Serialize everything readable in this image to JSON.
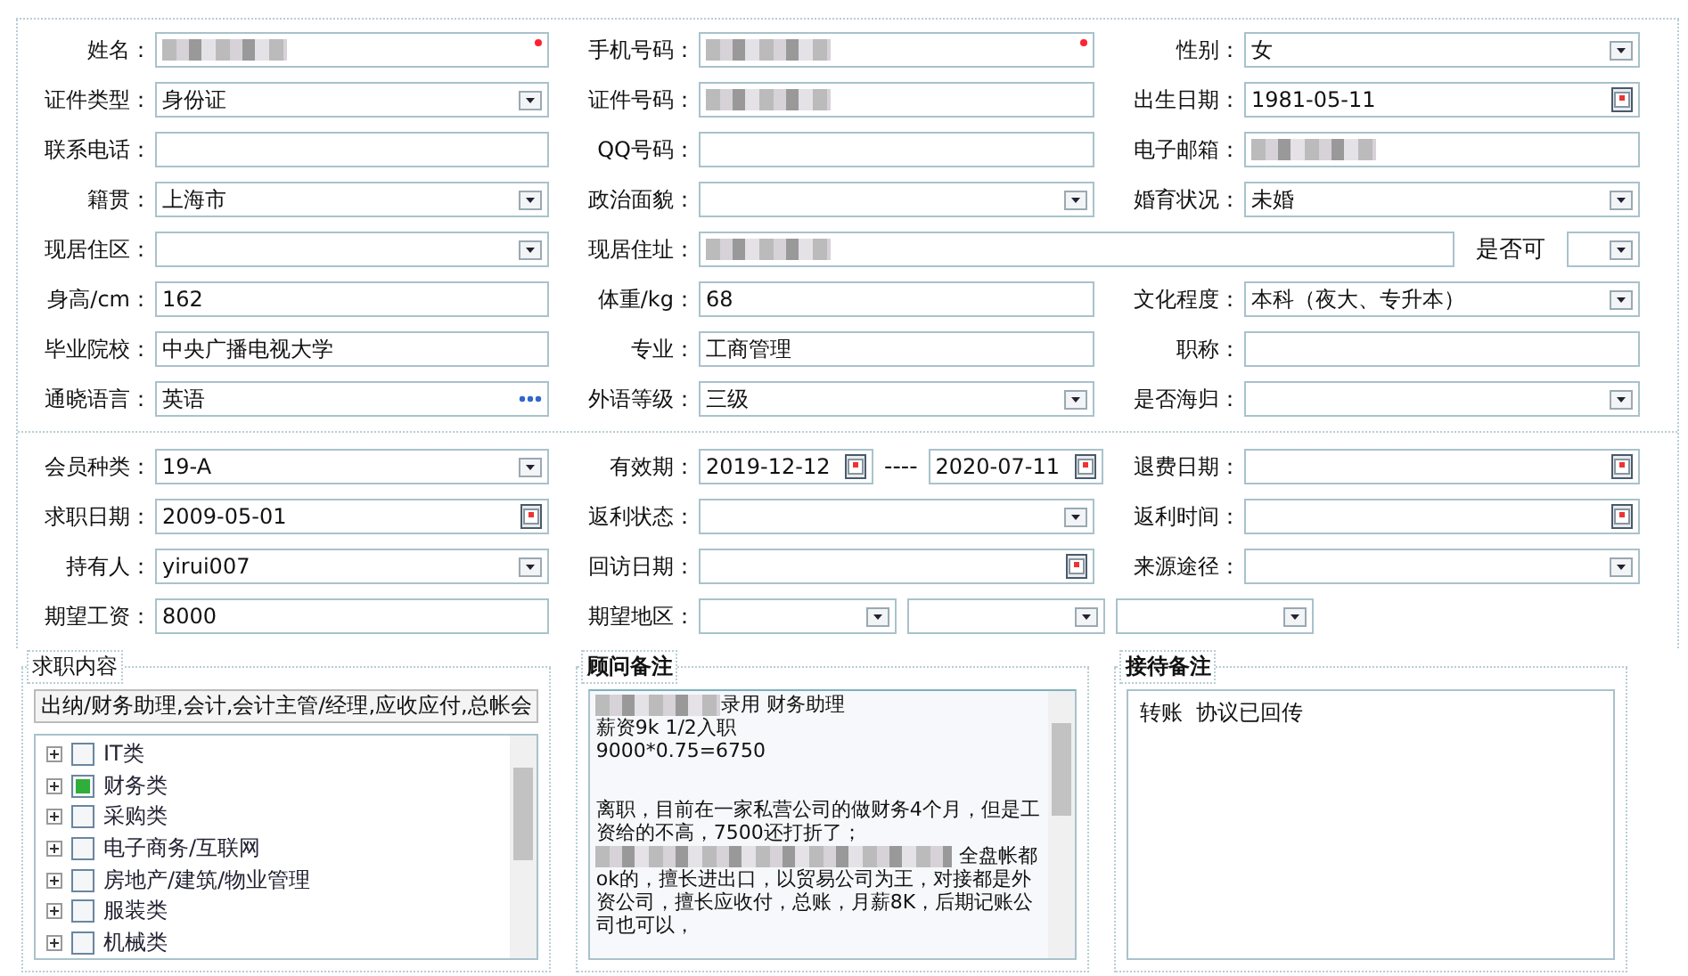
{
  "sections": [
    {
      "rows": [
        [
          {
            "label": "姓名：",
            "inputs": [
              {
                "kind": "text",
                "redacted": true,
                "required": true
              }
            ]
          },
          {
            "label": "手机号码：",
            "inputs": [
              {
                "kind": "text",
                "redacted": true,
                "required": true
              }
            ]
          },
          {
            "label": "性别：",
            "inputs": [
              {
                "kind": "select",
                "value": "女"
              }
            ]
          }
        ],
        [
          {
            "label": "证件类型：",
            "inputs": [
              {
                "kind": "select",
                "value": "身份证"
              }
            ]
          },
          {
            "label": "证件号码：",
            "inputs": [
              {
                "kind": "text",
                "redacted": true
              }
            ]
          },
          {
            "label": "出生日期：",
            "inputs": [
              {
                "kind": "date",
                "value": "1981-05-11"
              }
            ]
          }
        ],
        [
          {
            "label": "联系电话：",
            "inputs": [
              {
                "kind": "text"
              }
            ]
          },
          {
            "label": "QQ号码：",
            "inputs": [
              {
                "kind": "text"
              }
            ]
          },
          {
            "label": "电子邮箱：",
            "inputs": [
              {
                "kind": "text",
                "redacted": true
              }
            ]
          }
        ],
        [
          {
            "label": "籍贯：",
            "inputs": [
              {
                "kind": "select",
                "value": "上海市"
              }
            ]
          },
          {
            "label": "政治面貌：",
            "inputs": [
              {
                "kind": "select"
              }
            ]
          },
          {
            "label": "婚育状况：",
            "inputs": [
              {
                "kind": "select",
                "value": "未婚"
              }
            ]
          }
        ],
        [
          {
            "label": "现居住区：",
            "inputs": [
              {
                "kind": "select"
              }
            ]
          },
          {
            "label": "现居住址：",
            "wide": true,
            "inputs": [
              {
                "kind": "text",
                "redacted": true
              },
              {
                "kind": "label",
                "value": "是否可"
              },
              {
                "kind": "select"
              }
            ]
          }
        ],
        [
          {
            "label": "身高/cm：",
            "inputs": [
              {
                "kind": "text",
                "value": "162"
              }
            ]
          },
          {
            "label": "体重/kg：",
            "inputs": [
              {
                "kind": "text",
                "value": "68"
              }
            ]
          },
          {
            "label": "文化程度：",
            "inputs": [
              {
                "kind": "select",
                "value": "本科（夜大、专升本）"
              }
            ]
          }
        ],
        [
          {
            "label": "毕业院校：",
            "inputs": [
              {
                "kind": "text",
                "value": "中央广播电视大学"
              }
            ]
          },
          {
            "label": "专业：",
            "inputs": [
              {
                "kind": "text",
                "value": "工商管理"
              }
            ]
          },
          {
            "label": "职称：",
            "inputs": [
              {
                "kind": "text"
              }
            ]
          }
        ],
        [
          {
            "label": "通晓语言：",
            "inputs": [
              {
                "kind": "more",
                "value": "英语"
              }
            ]
          },
          {
            "label": "外语等级：",
            "inputs": [
              {
                "kind": "select",
                "value": "三级"
              }
            ]
          },
          {
            "label": "是否海归：",
            "inputs": [
              {
                "kind": "select"
              }
            ]
          }
        ]
      ]
    },
    {
      "rows": [
        [
          {
            "label": "会员种类：",
            "inputs": [
              {
                "kind": "select",
                "value": "19-A"
              }
            ]
          },
          {
            "label": "有效期：",
            "inputs": [
              {
                "kind": "date",
                "value": "2019-12-12"
              },
              {
                "kind": "sep",
                "value": "----"
              },
              {
                "kind": "date",
                "value": "2020-07-11"
              }
            ]
          },
          {
            "label": "退费日期：",
            "inputs": [
              {
                "kind": "date"
              }
            ]
          }
        ],
        [
          {
            "label": "求职日期：",
            "inputs": [
              {
                "kind": "date",
                "value": "2009-05-01"
              }
            ]
          },
          {
            "label": "返利状态：",
            "inputs": [
              {
                "kind": "select"
              }
            ]
          },
          {
            "label": "返利时间：",
            "inputs": [
              {
                "kind": "date"
              }
            ]
          }
        ],
        [
          {
            "label": "持有人：",
            "inputs": [
              {
                "kind": "select",
                "value": "yirui007"
              }
            ]
          },
          {
            "label": "回访日期：",
            "inputs": [
              {
                "kind": "date"
              }
            ]
          },
          {
            "label": "来源途径：",
            "inputs": [
              {
                "kind": "select"
              }
            ]
          }
        ],
        [
          {
            "label": "期望工资：",
            "inputs": [
              {
                "kind": "text",
                "value": "8000"
              }
            ]
          },
          {
            "label": "期望地区：",
            "wide": true,
            "inputs": [
              {
                "kind": "select"
              },
              {
                "kind": "select"
              },
              {
                "kind": "select"
              }
            ]
          }
        ]
      ]
    }
  ],
  "job_panel": {
    "title": "求职内容",
    "summary": "出纳/财务助理,会计,会计主管/经理,应收应付,总帐会",
    "tree": [
      {
        "label": "IT类",
        "checked": false,
        "expanded": false
      },
      {
        "label": "财务类",
        "checked": true,
        "expanded": false
      },
      {
        "label": "采购类",
        "checked": false,
        "expanded": false
      },
      {
        "label": "电子商务/互联网",
        "checked": false,
        "expanded": false
      },
      {
        "label": "房地产/建筑/物业管理",
        "checked": false,
        "expanded": false
      },
      {
        "label": "服装类",
        "checked": false,
        "expanded": false
      },
      {
        "label": "机械类",
        "checked": false,
        "expanded": false
      }
    ]
  },
  "advisor_panel": {
    "title": "顾问备注",
    "paragraphs": [
      {
        "segments": [
          {
            "kind": "redacted"
          },
          {
            "kind": "text",
            "text": "录用   财务助理"
          }
        ]
      },
      {
        "segments": [
          {
            "kind": "text",
            "text": "薪资9k  1/2入职"
          }
        ]
      },
      {
        "segments": [
          {
            "kind": "text",
            "text": "9000*0.75=6750"
          }
        ]
      },
      {
        "spaced": true,
        "segments": [
          {
            "kind": "text",
            "text": "离职，目前在一家私营公司的做财务4个月，但是工资给的不高，7500还打折了；"
          },
          {
            "kind": "redacted"
          },
          {
            "kind": "text",
            "text": " 全盘帐都ok的，擅长进出口，以贸易公司为王，对接都是外资公司，擅长应收付，总账，月薪8K，后期记账公司也可以，"
          }
        ]
      }
    ]
  },
  "reception_panel": {
    "title": "接待备注",
    "text": "转账  协议已回传"
  }
}
